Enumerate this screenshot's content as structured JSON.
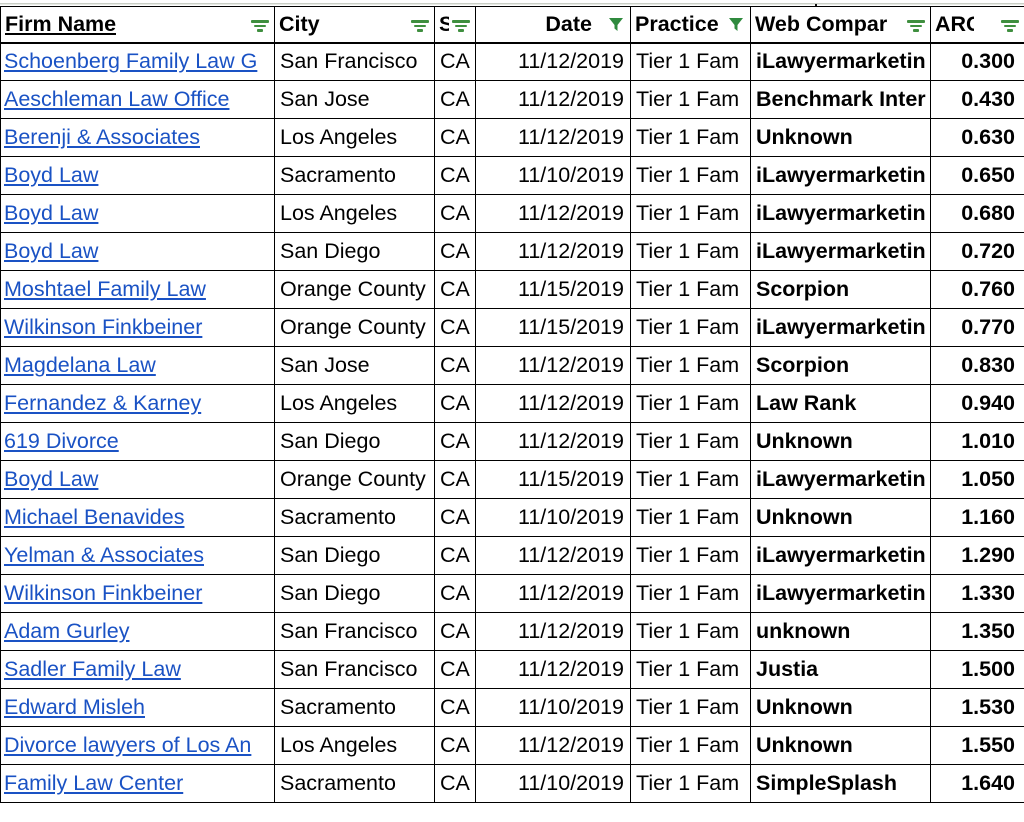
{
  "table": {
    "columns": [
      {
        "key": "firm",
        "label": "Firm Name",
        "filter_icon": "sort-filter-icon",
        "filtered": false
      },
      {
        "key": "city",
        "label": "City",
        "filter_icon": "sort-filter-icon",
        "filtered": false
      },
      {
        "key": "st",
        "label": "St",
        "filter_icon": "sort-filter-icon",
        "filtered": false
      },
      {
        "key": "date",
        "label": "Date",
        "filter_icon": "funnel-icon",
        "filtered": true
      },
      {
        "key": "prac",
        "label": "Practice",
        "filter_icon": "funnel-icon",
        "filtered": true
      },
      {
        "key": "web",
        "label": "Web Compar",
        "filter_icon": "sort-filter-icon",
        "filtered": false
      },
      {
        "key": "arc",
        "label": "ARC",
        "filter_icon": "sort-filter-icon",
        "filtered": false
      }
    ],
    "accent_link_color": "#1a52c4",
    "filter_icon_color": "#3f8f3f",
    "rows": [
      {
        "firm": "Schoenberg Family Law G",
        "city": "San Francisco",
        "st": "CA",
        "date": "11/12/2019",
        "prac": "Tier 1 Fam",
        "web": "iLawyermarketin",
        "arc": "0.300"
      },
      {
        "firm": "Aeschleman Law Office",
        "city": "San Jose",
        "st": "CA",
        "date": "11/12/2019",
        "prac": "Tier 1 Fam",
        "web": "Benchmark Inter",
        "arc": "0.430"
      },
      {
        "firm": "Berenji & Associates",
        "city": "Los Angeles",
        "st": "CA",
        "date": "11/12/2019",
        "prac": "Tier 1 Fam",
        "web": "Unknown",
        "arc": "0.630"
      },
      {
        "firm": "Boyd Law",
        "city": "Sacramento",
        "st": "CA",
        "date": "11/10/2019",
        "prac": "Tier 1 Fam",
        "web": "iLawyermarketin",
        "arc": "0.650"
      },
      {
        "firm": "Boyd Law",
        "city": "Los Angeles",
        "st": "CA",
        "date": "11/12/2019",
        "prac": "Tier 1 Fam",
        "web": "iLawyermarketin",
        "arc": "0.680"
      },
      {
        "firm": "Boyd Law ",
        "city": "San Diego",
        "st": "CA",
        "date": "11/12/2019",
        "prac": "Tier 1 Fam",
        "web": "iLawyermarketin",
        "arc": "0.720"
      },
      {
        "firm": "Moshtael Family Law",
        "city": "Orange County",
        "st": "CA",
        "date": "11/15/2019",
        "prac": "Tier 1 Fam",
        "web": "Scorpion",
        "arc": "0.760"
      },
      {
        "firm": "Wilkinson Finkbeiner",
        "city": "Orange County",
        "st": "CA",
        "date": "11/15/2019",
        "prac": "Tier 1 Fam",
        "web": "iLawyermarketin",
        "arc": "0.770"
      },
      {
        "firm": "Magdelana Law",
        "city": "San Jose",
        "st": "CA",
        "date": "11/12/2019",
        "prac": "Tier 1 Fam",
        "web": "Scorpion",
        "arc": "0.830"
      },
      {
        "firm": "Fernandez & Karney",
        "city": "Los Angeles",
        "st": "CA",
        "date": "11/12/2019",
        "prac": "Tier 1 Fam",
        "web": "Law Rank",
        "arc": "0.940"
      },
      {
        "firm": "619 Divorce",
        "city": "San Diego",
        "st": "CA",
        "date": "11/12/2019",
        "prac": "Tier 1 Fam",
        "web": "Unknown",
        "arc": "1.010"
      },
      {
        "firm": "Boyd Law",
        "city": "Orange County",
        "st": "CA",
        "date": "11/15/2019",
        "prac": "Tier 1 Fam",
        "web": "iLawyermarketin",
        "arc": "1.050"
      },
      {
        "firm": "Michael Benavides",
        "city": "Sacramento",
        "st": "CA",
        "date": "11/10/2019",
        "prac": "Tier 1 Fam",
        "web": "Unknown",
        "arc": "1.160"
      },
      {
        "firm": "Yelman & Associates",
        "city": "San Diego",
        "st": "CA",
        "date": "11/12/2019",
        "prac": "Tier 1 Fam",
        "web": "iLawyermarketin",
        "arc": "1.290"
      },
      {
        "firm": "Wilkinson Finkbeiner",
        "city": "San Diego",
        "st": "CA",
        "date": "11/12/2019",
        "prac": "Tier 1 Fam",
        "web": "iLawyermarketin",
        "arc": "1.330"
      },
      {
        "firm": "Adam Gurley",
        "city": "San Francisco",
        "st": "CA",
        "date": "11/12/2019",
        "prac": "Tier 1 Fam",
        "web": "unknown",
        "arc": "1.350"
      },
      {
        "firm": "Sadler Family Law",
        "city": "San Francisco",
        "st": "CA",
        "date": "11/12/2019",
        "prac": "Tier 1 Fam",
        "web": "Justia",
        "arc": "1.500"
      },
      {
        "firm": "Edward Misleh",
        "city": "Sacramento",
        "st": "CA",
        "date": "11/10/2019",
        "prac": "Tier 1 Fam",
        "web": "Unknown",
        "arc": "1.530"
      },
      {
        "firm": "Divorce lawyers of Los An",
        "city": "Los Angeles",
        "st": "CA",
        "date": "11/12/2019",
        "prac": "Tier 1 Fam",
        "web": "Unknown",
        "arc": "1.550"
      },
      {
        "firm": "Family Law Center",
        "city": "Sacramento",
        "st": "CA",
        "date": "11/10/2019",
        "prac": "Tier 1 Fam",
        "web": "SimpleSplash",
        "arc": "1.640"
      }
    ]
  }
}
